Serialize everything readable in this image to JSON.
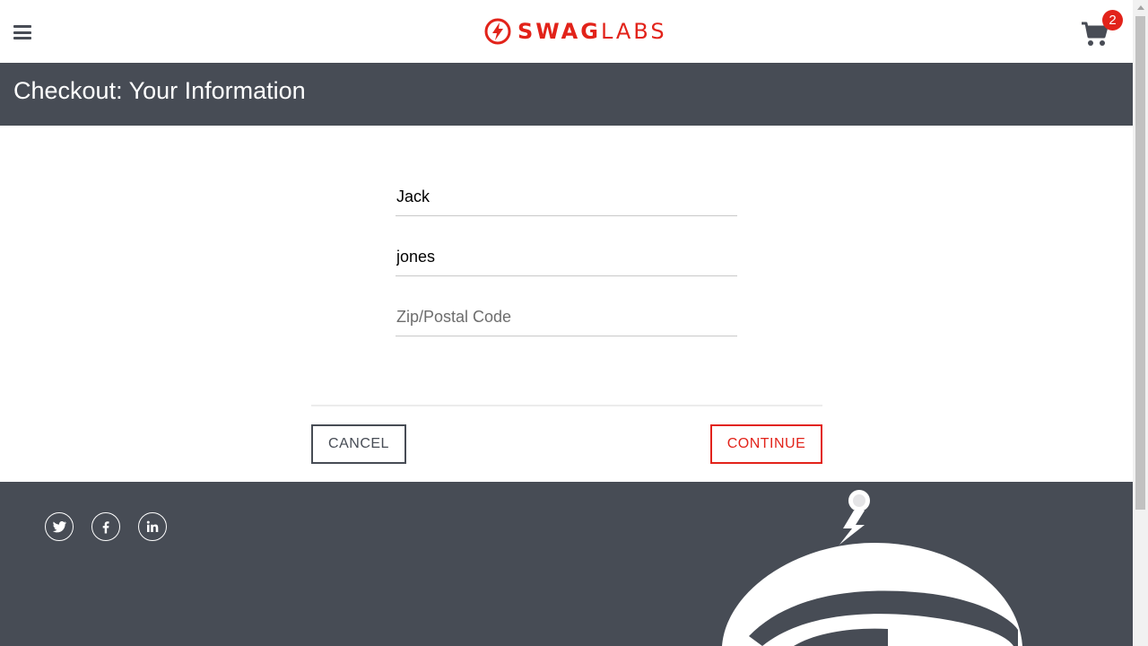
{
  "header": {
    "logo_bold": "SWAG",
    "logo_light": "LABS",
    "cart_count": "2",
    "menu_icon": "hamburger-menu-icon",
    "cart_icon": "shopping-cart-icon"
  },
  "subheader": {
    "title": "Checkout: Your Information"
  },
  "form": {
    "first_name_value": "Jack",
    "last_name_value": "jones",
    "postal_code_value": "",
    "postal_code_placeholder": "Zip/Postal Code"
  },
  "actions": {
    "cancel_label": "Cancel",
    "continue_label": "Continue"
  },
  "footer": {
    "social_icons": [
      "twitter-icon",
      "facebook-icon",
      "linkedin-icon"
    ]
  },
  "colors": {
    "brand_red": "#e2231a",
    "dark_gray": "#474c55",
    "white": "#ffffff"
  }
}
